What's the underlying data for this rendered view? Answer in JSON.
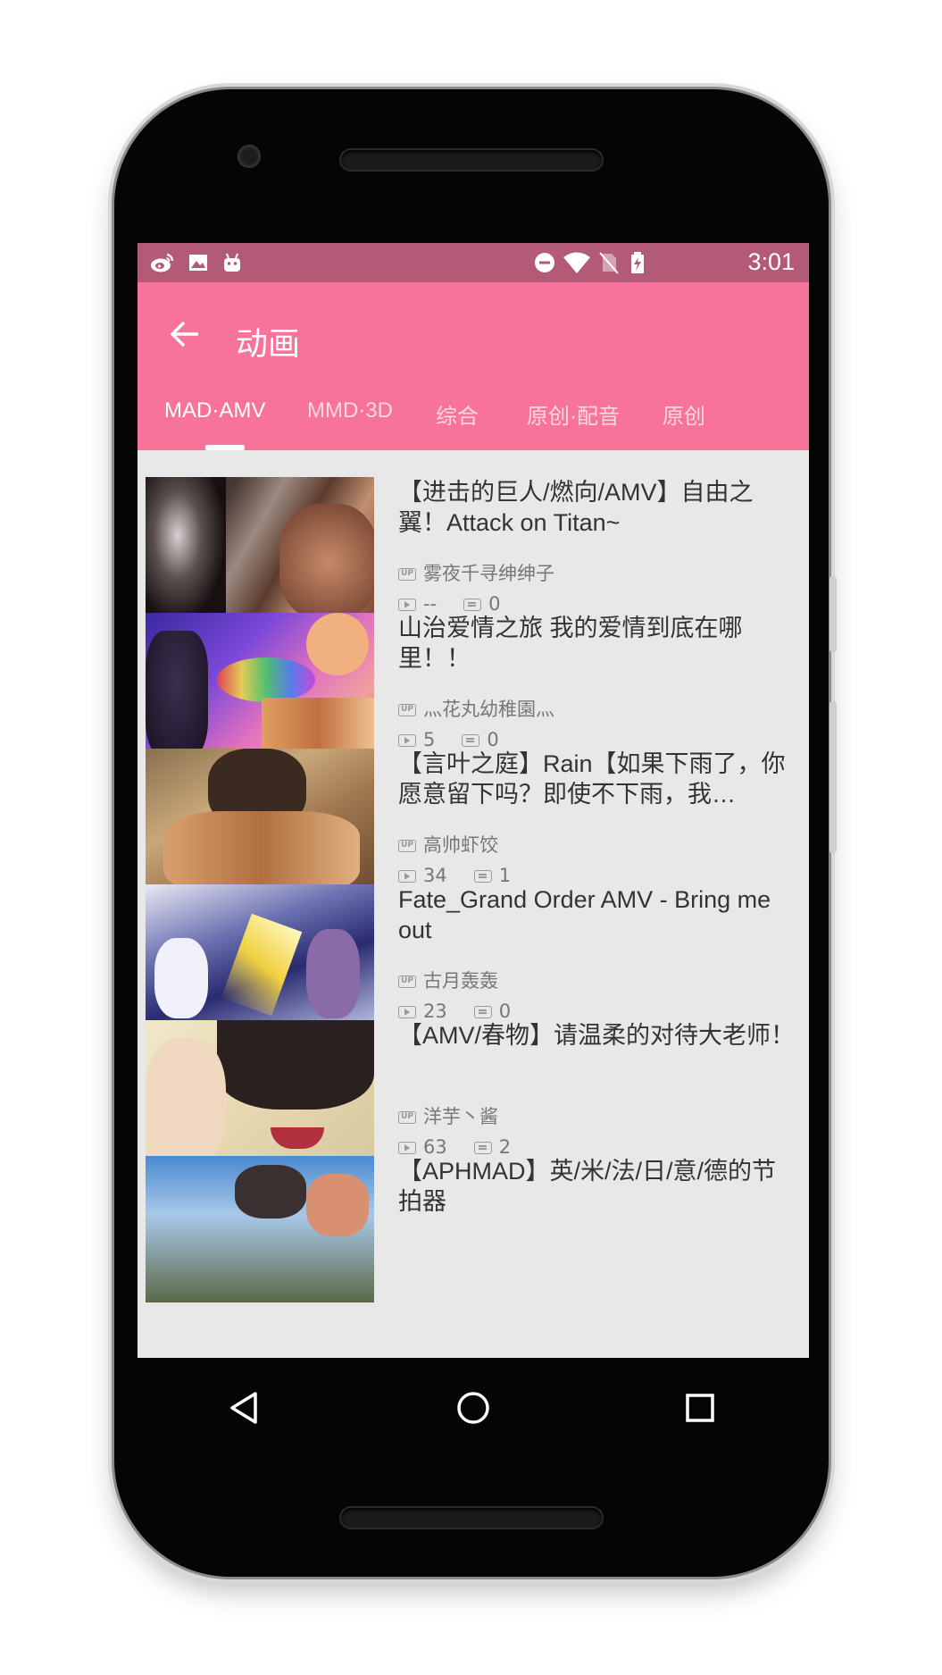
{
  "status_bar": {
    "time": "3:01",
    "left_icons": [
      "weibo-icon",
      "image-icon",
      "android-icon"
    ],
    "right_icons": [
      "dnd-icon",
      "wifi-icon",
      "no-sim-icon",
      "battery-charging-icon"
    ]
  },
  "app_bar": {
    "title": "动画",
    "back_icon": "arrow-left-icon",
    "color": "#f87399"
  },
  "tabs": [
    {
      "label": "MAD·AMV",
      "active": true
    },
    {
      "label": "MMD·3D",
      "active": false
    },
    {
      "label": "综合",
      "active": false
    },
    {
      "label": "原创·配音",
      "active": false
    },
    {
      "label": "原创",
      "active": false
    }
  ],
  "videos": [
    {
      "title": "【进击的巨人/燃向/AMV】自由之翼！Attack on Titan~",
      "uploader": "雾夜千寻绅绅子",
      "plays": "--",
      "danmaku": "0"
    },
    {
      "title": "山治爱情之旅 我的爱情到底在哪里！！",
      "uploader": "灬花丸幼稚園灬",
      "plays": "5",
      "danmaku": "0"
    },
    {
      "title": "【言叶之庭】Rain【如果下雨了，你愿意留下吗？即使不下雨，我…",
      "uploader": "高帅虾饺",
      "plays": "34",
      "danmaku": "1"
    },
    {
      "title": "Fate_Grand Order AMV - Bring me out",
      "uploader": "古月轰轰",
      "plays": "23",
      "danmaku": "0"
    },
    {
      "title": "【AMV/春物】请温柔的对待大老师！",
      "uploader": "洋芋丶酱",
      "plays": "63",
      "danmaku": "2"
    },
    {
      "title": "【APHMAD】英/米/法/日/意/德的节拍器",
      "uploader": "",
      "plays": "",
      "danmaku": ""
    }
  ],
  "nav_bar": {
    "buttons": [
      "back-triangle-icon",
      "home-circle-icon",
      "recents-square-icon"
    ]
  }
}
